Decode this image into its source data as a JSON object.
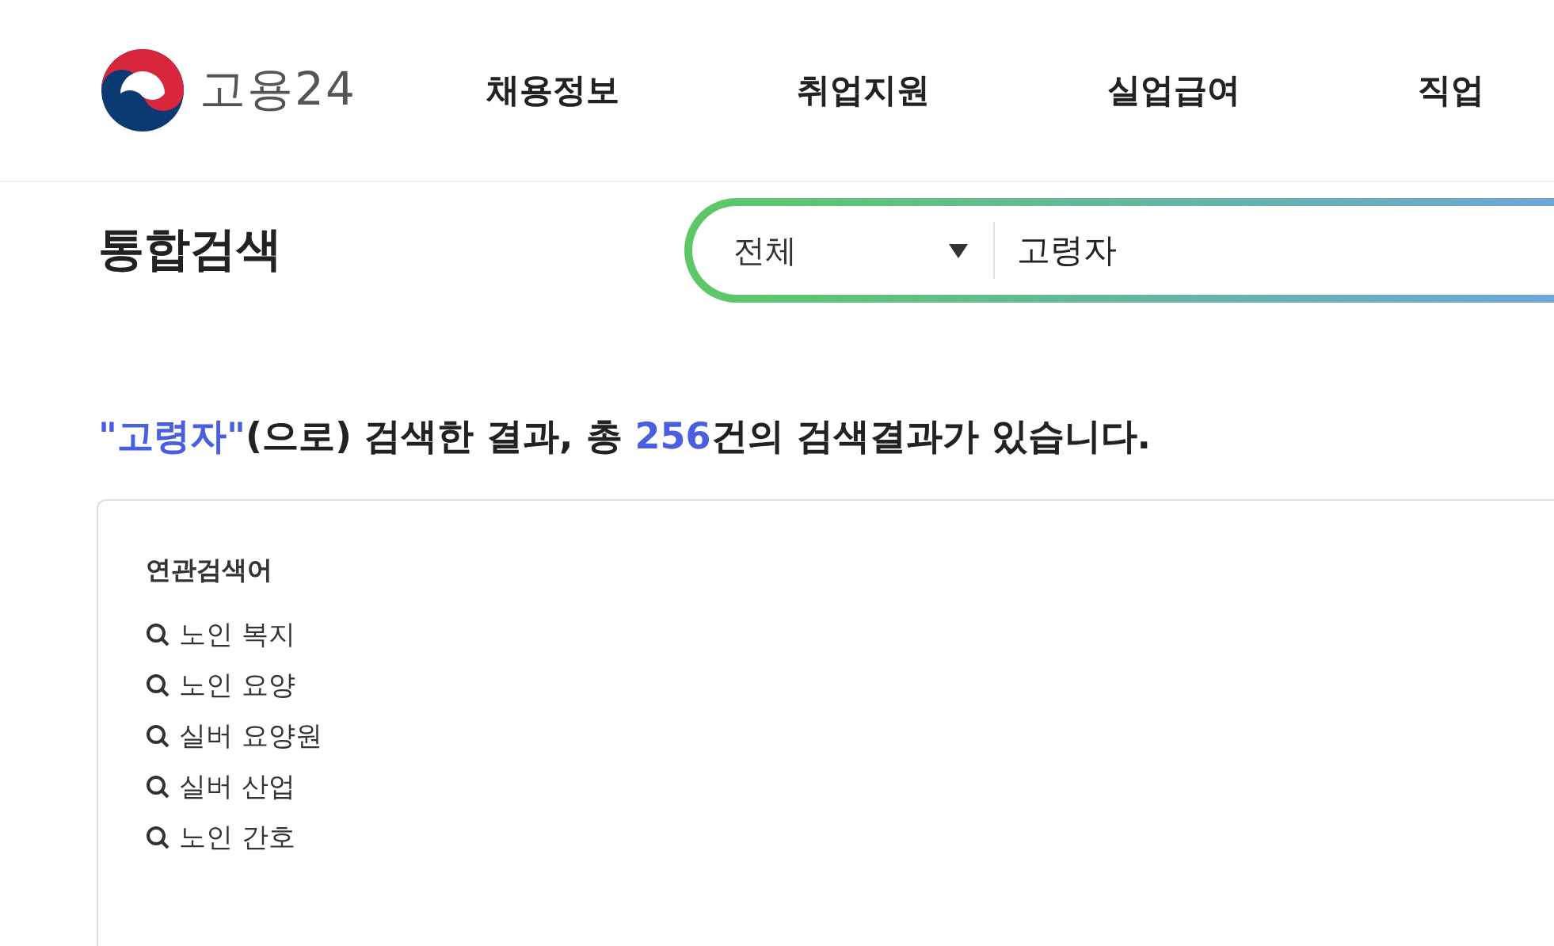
{
  "header": {
    "logo_text": "고용24",
    "nav": [
      {
        "label": "채용정보"
      },
      {
        "label": "취업지원"
      },
      {
        "label": "실업급여"
      },
      {
        "label": "직업"
      }
    ]
  },
  "search": {
    "title": "통합검색",
    "category": "전체",
    "value": "고령자"
  },
  "result_summary": [
    {
      "text": "\"고령자\"",
      "highlight": true
    },
    {
      "text": "(으로) 검색한 결과, 총 ",
      "highlight": false
    },
    {
      "text": "256",
      "highlight": true
    },
    {
      "text": "건의 검색결과가 있습니다.",
      "highlight": false
    }
  ],
  "related": {
    "title": "연관검색어",
    "items": [
      "노인 복지",
      "노인 요양",
      "실버 요양원",
      "실버 산업",
      "노인 간호"
    ]
  }
}
